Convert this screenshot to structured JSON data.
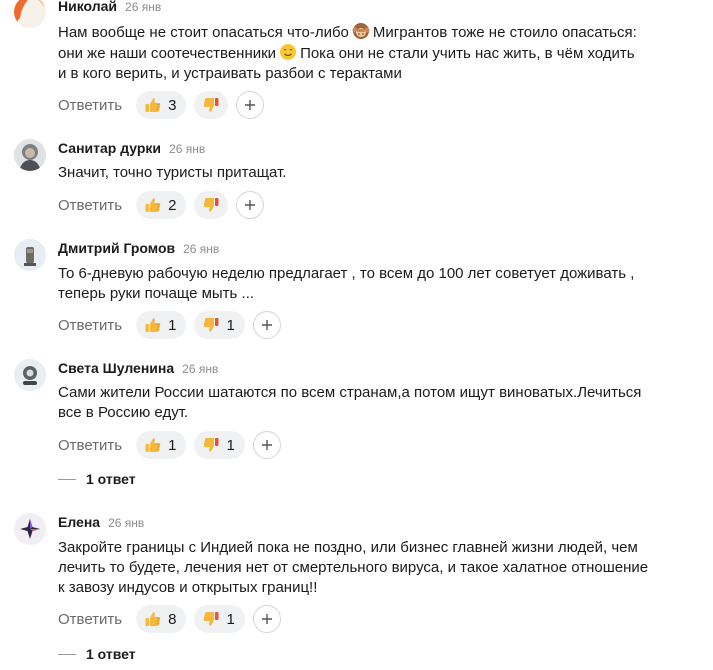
{
  "reply_label": "Ответить",
  "comments": [
    {
      "author": "Николай",
      "date": "26 янв",
      "text_lines": [
        [
          "Нам вообще не стоит опасаться что-либо",
          "Мигрантов тоже не стоило опасаться:"
        ],
        [
          "они же наши соотечественники",
          "Пока они не стали учить нас жить, в чём ходить"
        ],
        [
          "и в кого верить, и устраивать разбои с терактами"
        ]
      ],
      "likes": "3",
      "dislikes": ""
    },
    {
      "author": "Санитар дурки",
      "date": "26 янв",
      "text_lines": [
        [
          "Значит, точно туристы притащат."
        ]
      ],
      "likes": "2",
      "dislikes": ""
    },
    {
      "author": "Дмитрий Громов",
      "date": "26 янв",
      "text_lines": [
        [
          "То 6-дневую рабочую неделю предлагает , то всем до 100 лет советует доживать ,"
        ],
        [
          "теперь руки почаще мыть ..."
        ]
      ],
      "likes": "1",
      "dislikes": "1"
    },
    {
      "author": "Света Шуленина",
      "date": "26 янв",
      "text_lines": [
        [
          "Сами жители России шатаются по всем странам,а потом ищут виноватых.Лечиться"
        ],
        [
          "все в Россию едут."
        ]
      ],
      "likes": "1",
      "dislikes": "1",
      "replies": "1 ответ"
    },
    {
      "author": "Елена",
      "date": "26 янв",
      "text_lines": [
        [
          "Закройте границы с Индией пока не поздно, или бизнес главней жизни людей, чем"
        ],
        [
          "лечить то будете, лечения нет от смертельного вируса, и такое халатное отношение"
        ],
        [
          "к завозу индусов и открытых границ!!"
        ]
      ],
      "likes": "8",
      "dislikes": "1",
      "replies": "1 ответ"
    }
  ],
  "colors": {
    "pill_bg": "#f0f1f3",
    "thumb_yellow": "#f6b73c",
    "thumb_red": "#e5533a",
    "muted": "#8c8c8c"
  },
  "icons": [
    "thumbs-up-icon",
    "thumbs-down-icon",
    "plus-icon",
    "monkey-emoji",
    "smile-emoji"
  ]
}
